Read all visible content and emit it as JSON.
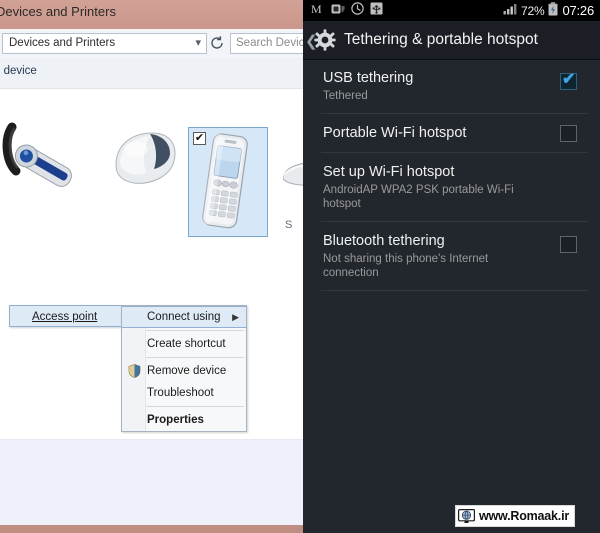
{
  "windows": {
    "window_title": "Devices and Printers",
    "address_value": "Devices and Printers",
    "address_chevron": "chevron-down-icon",
    "refresh_icon": "refresh-icon",
    "search_placeholder": "Search Devices",
    "toolbar_text": "e device",
    "devices": [
      {
        "name": "bluetooth-headset",
        "label": ""
      },
      {
        "name": "computer-mouse",
        "label": ""
      },
      {
        "name": "mobile-phone",
        "label": "",
        "selected": true,
        "checkbox": "✔"
      },
      {
        "name": "partial-device",
        "label": "S"
      }
    ],
    "context_menu": {
      "parent_item": "Access point",
      "parent_underline": "A",
      "items": [
        {
          "label": "Connect using",
          "underline": "C",
          "submenu_arrow": "▶",
          "highlighted": true,
          "bold": false,
          "icon": ""
        },
        {
          "label": "Create shortcut",
          "underline": "s",
          "submenu_arrow": "",
          "highlighted": false,
          "bold": false,
          "icon": ""
        },
        {
          "label": "Remove device",
          "underline": "v",
          "submenu_arrow": "",
          "highlighted": false,
          "bold": false,
          "icon": "uac-shield-icon"
        },
        {
          "label": "Troubleshoot",
          "underline": "T",
          "submenu_arrow": "",
          "highlighted": false,
          "bold": false,
          "icon": ""
        },
        {
          "label": "Properties",
          "underline": "P",
          "submenu_arrow": "",
          "highlighted": false,
          "bold": true,
          "icon": ""
        }
      ]
    }
  },
  "android": {
    "status_bar": {
      "icons": [
        "gmail-icon",
        "screenshot-icon",
        "clock-icon",
        "usb-icon",
        "signal-bars-icon",
        "battery-charging-icon"
      ],
      "battery_percent": "72%",
      "clock": "07:26"
    },
    "action_bar": {
      "back_icon": "back-chevron-icon",
      "app_icon": "gear-icon",
      "title": "Tethering & portable hotspot"
    },
    "settings": [
      {
        "title": "USB tethering",
        "subtitle": "Tethered",
        "checkbox": "checked",
        "check_glyph": "✔"
      },
      {
        "title": "Portable Wi-Fi hotspot",
        "subtitle": "",
        "checkbox": "unchecked",
        "check_glyph": ""
      },
      {
        "title": "Set up Wi-Fi hotspot",
        "subtitle": "AndroidAP WPA2 PSK portable Wi-Fi hotspot",
        "checkbox": "none",
        "check_glyph": ""
      },
      {
        "title": "Bluetooth tethering",
        "subtitle": "Not sharing this phone's Internet connection",
        "checkbox": "unchecked",
        "check_glyph": ""
      }
    ]
  },
  "watermark": {
    "icon": "website-monitor-icon",
    "text": "www.Romaak.ir"
  },
  "colors": {
    "windows_titlebar": "#cf9d92",
    "windows_selection": "#d6e8f7",
    "android_background": "#22262d",
    "android_accent": "#3ea8e5",
    "status_bar": "#000000"
  }
}
